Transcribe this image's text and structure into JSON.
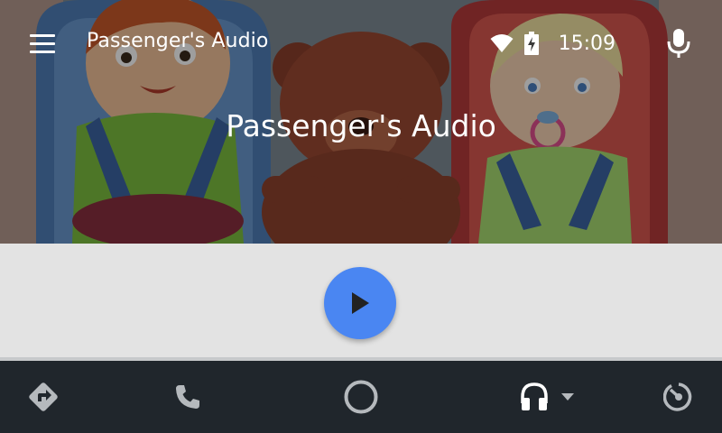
{
  "app": {
    "title": "Passenger's Audio",
    "menu_icon": "hamburger-menu-icon",
    "mic_icon": "microphone-icon"
  },
  "status_bar": {
    "time": "15:09",
    "wifi_icon": "wifi-icon",
    "battery_icon": "battery-charging-icon"
  },
  "now_playing": {
    "title": "Passenger's Audio",
    "artwork": "cartoon-children-in-car-seats-with-teddy-bear",
    "play_icon": "play-icon"
  },
  "navbar": {
    "items": [
      {
        "name": "navigation",
        "icon": "navigation-arrow-icon"
      },
      {
        "name": "phone",
        "icon": "phone-icon"
      },
      {
        "name": "home",
        "icon": "home-circle-icon"
      },
      {
        "name": "audio",
        "icon": "headphones-icon",
        "active": true
      },
      {
        "name": "car",
        "icon": "gauge-icon"
      }
    ]
  },
  "colors": {
    "accent": "#4a86f2",
    "controls_bg": "#e3e3e3",
    "navbar_bg": "#20262c",
    "nav_icon": "#b5b9bd",
    "nav_icon_active": "#ffffff"
  }
}
